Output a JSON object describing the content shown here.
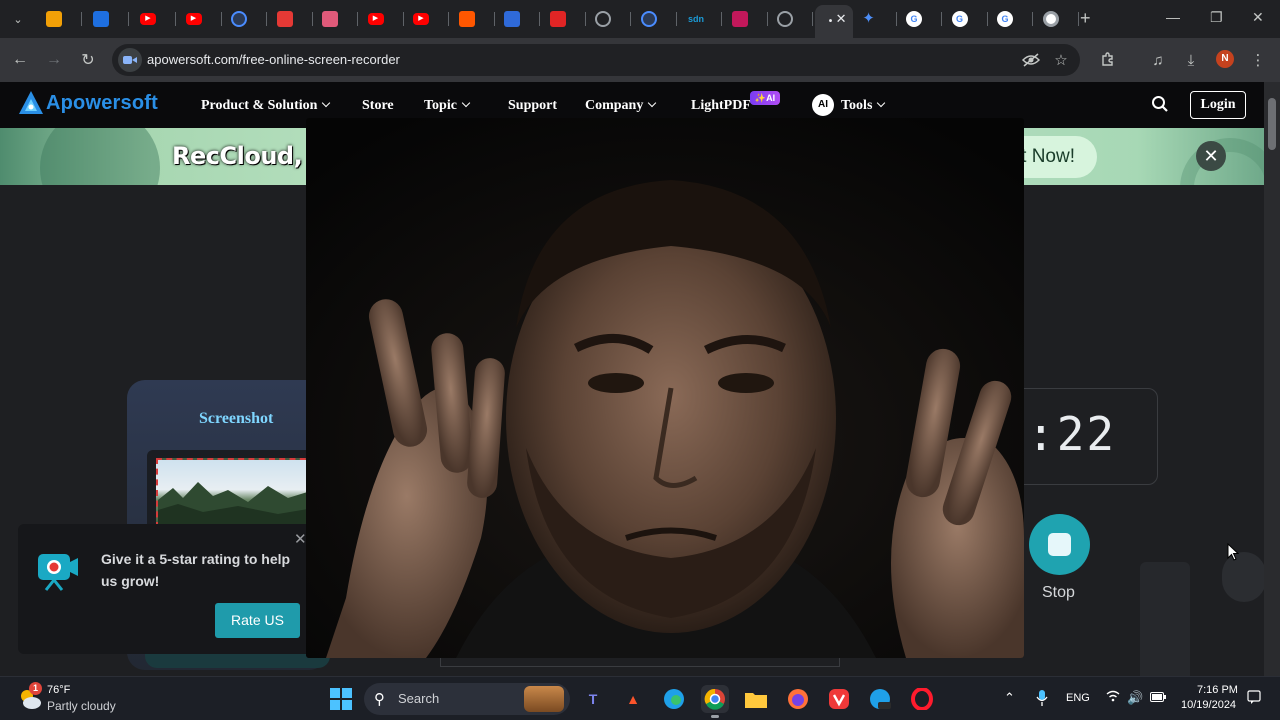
{
  "browser": {
    "tabs": [
      {
        "icon": "stack-icon",
        "color": "#f2a007"
      },
      {
        "icon": "tools-icon",
        "color": "#1e6fe0"
      },
      {
        "icon": "youtube-icon",
        "color": "#ff0000"
      },
      {
        "icon": "youtube-icon",
        "color": "#ff0000"
      },
      {
        "icon": "circle-icon",
        "color": "#4a8cff"
      },
      {
        "icon": "pdf-icon",
        "color": "#e53935"
      },
      {
        "icon": "image-icon",
        "color": "#e05a7a"
      },
      {
        "icon": "youtube-icon",
        "color": "#ff0000"
      },
      {
        "icon": "youtube-icon",
        "color": "#ff0000"
      },
      {
        "icon": "reddit-icon",
        "color": "#ff5700"
      },
      {
        "icon": "shield-icon",
        "color": "#2f6ad9"
      },
      {
        "icon": "y-icon",
        "color": "#e02525"
      },
      {
        "icon": "globe-icon",
        "color": "#9aa0a6"
      },
      {
        "icon": "circle-icon",
        "color": "#4a8cff"
      },
      {
        "icon": "sdn-icon",
        "color": "#1b9ad6",
        "text": "sdn"
      },
      {
        "icon": "puzzle-icon",
        "color": "#c2185b"
      },
      {
        "icon": "globe-icon",
        "color": "#9aa0a6"
      },
      {
        "icon": "apowersoft-icon",
        "color": "#35363a",
        "active": true
      },
      {
        "icon": "gemini-icon",
        "color": "#4c8df6"
      },
      {
        "icon": "google-icon",
        "color": "#ffffff"
      },
      {
        "icon": "google-icon",
        "color": "#ffffff"
      },
      {
        "icon": "google-icon",
        "color": "#ffffff"
      },
      {
        "icon": "chrome-icon",
        "color": "#ffffff"
      }
    ],
    "url": "apowersoft.com/free-online-screen-recorder",
    "profile_initial": "N"
  },
  "site": {
    "logo_text": "Apowersoft",
    "nav": {
      "product": "Product & Solution",
      "store": "Store",
      "topic": "Topic",
      "support": "Support",
      "company": "Company",
      "lightpdf": "LightPDF",
      "ai_badge": "✨AI",
      "ai_icon": "AI",
      "tools": "Tools",
      "login": "Login"
    },
    "banner": {
      "title": "RecCloud, New",
      "cta": "t Now!"
    },
    "recorder": {
      "screenshot_label": "Screenshot",
      "timer": ":22",
      "stop_label": "Stop"
    },
    "rating_popup": {
      "message": "Give it a 5-star rating to help us grow!",
      "button": "Rate US"
    }
  },
  "taskbar": {
    "weather_temp": "76°F",
    "weather_desc": "Partly cloudy",
    "weather_badge": "1",
    "search_placeholder": "Search",
    "language": "ENG",
    "time": "7:16 PM",
    "date": "10/19/2024"
  },
  "colors": {
    "accent": "#1f9bab",
    "brand": "#2a8fe6",
    "banner_green": "#b3dec0"
  }
}
